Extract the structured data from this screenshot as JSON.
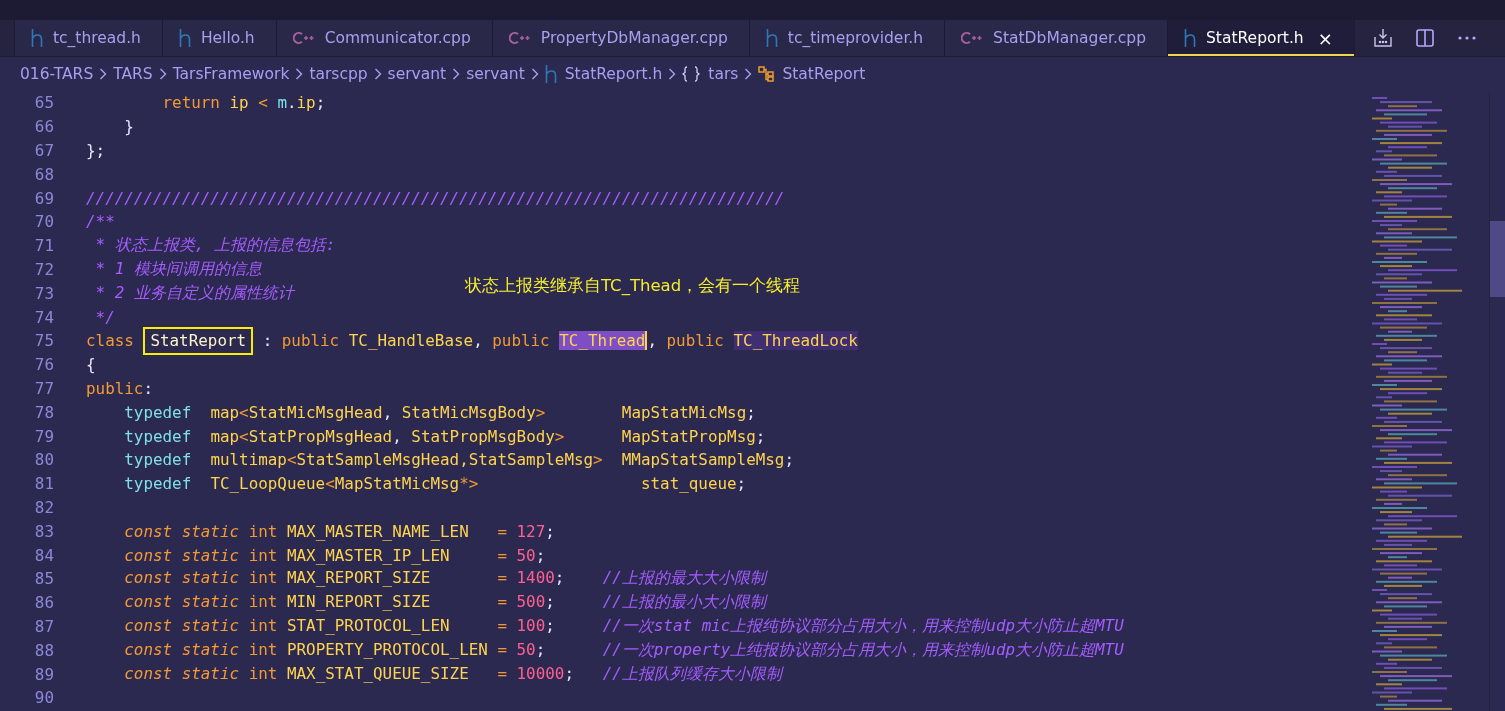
{
  "tabs": [
    {
      "kind": "h",
      "label": "tc_thread.h",
      "selected": false
    },
    {
      "kind": "h",
      "label": "Hello.h",
      "selected": false
    },
    {
      "kind": "cpp",
      "label": "Communicator.cpp",
      "selected": false
    },
    {
      "kind": "cpp",
      "label": "PropertyDbManager.cpp",
      "selected": false
    },
    {
      "kind": "h",
      "label": "tc_timeprovider.h",
      "selected": false
    },
    {
      "kind": "cpp",
      "label": "StatDbManager.cpp",
      "selected": false
    },
    {
      "kind": "h",
      "label": "StatReport.h",
      "selected": true,
      "close": "×"
    }
  ],
  "breadcrumb": [
    {
      "kind": "folder",
      "label": "016-TARS"
    },
    {
      "kind": "folder",
      "label": "TARS"
    },
    {
      "kind": "folder",
      "label": "TarsFramework"
    },
    {
      "kind": "folder",
      "label": "tarscpp"
    },
    {
      "kind": "folder",
      "label": "servant"
    },
    {
      "kind": "folder",
      "label": "servant"
    },
    {
      "kind": "file",
      "label": "StatReport.h"
    },
    {
      "kind": "namespace",
      "label": "tars"
    },
    {
      "kind": "class",
      "label": "StatReport"
    }
  ],
  "editor": {
    "lines": [
      {
        "number": "65",
        "tokens": [
          {
            "kind": "kw",
            "text": "        return"
          },
          {
            "kind": "ident",
            "text": " ip "
          },
          {
            "kind": "kw",
            "text": "<"
          },
          {
            "kind": "type",
            "text": " m"
          },
          {
            "kind": "punct",
            "text": "."
          },
          {
            "kind": "ident",
            "text": "ip"
          },
          {
            "kind": "punct",
            "text": ";"
          }
        ]
      },
      {
        "number": "66",
        "tokens": [
          {
            "kind": "punct",
            "text": "    }"
          }
        ]
      },
      {
        "number": "67",
        "tokens": [
          {
            "kind": "punct",
            "text": "};"
          }
        ]
      },
      {
        "number": "68"
      },
      {
        "number": "69",
        "tokens": [
          {
            "kind": "comment",
            "text": "/////////////////////////////////////////////////////////////////////////"
          }
        ]
      },
      {
        "number": "70",
        "tokens": [
          {
            "kind": "comment",
            "text": "/**"
          }
        ]
      },
      {
        "number": "71",
        "tokens": [
          {
            "kind": "comment",
            "text": " * 状态上报类, 上报的信息包括:"
          }
        ]
      },
      {
        "number": "72",
        "tokens": [
          {
            "kind": "comment",
            "text": " * 1 模块间调用的信息"
          }
        ]
      },
      {
        "number": "73",
        "tokens": [
          {
            "kind": "comment",
            "text": " * 2 业务自定义的属性统计"
          }
        ]
      },
      {
        "number": "74",
        "tokens": [
          {
            "kind": "comment",
            "text": " */"
          }
        ]
      },
      {
        "number": "75",
        "tokens": [
          {
            "kind": "kw",
            "text": "class "
          },
          {
            "kind": "boxed",
            "text": "StatReport"
          },
          {
            "kind": "punct",
            "text": " : "
          },
          {
            "kind": "kw",
            "text": "public"
          },
          {
            "kind": "ident",
            "text": " TC_HandleBase"
          },
          {
            "kind": "punct",
            "text": ", "
          },
          {
            "kind": "kw",
            "text": "public "
          },
          {
            "kind": "selected",
            "text": "TC_Thread"
          },
          {
            "kind": "punct",
            "text": ", "
          },
          {
            "kind": "kw",
            "text": "public "
          },
          {
            "kind": "match",
            "text": "TC_ThreadLock"
          }
        ]
      },
      {
        "number": "76",
        "tokens": [
          {
            "kind": "punct",
            "text": "{"
          }
        ]
      },
      {
        "number": "77",
        "tokens": [
          {
            "kind": "kw",
            "text": "public"
          },
          {
            "kind": "punct",
            "text": ":"
          }
        ]
      },
      {
        "number": "78",
        "tokens": [
          {
            "kind": "type",
            "text": "    typedef"
          },
          {
            "kind": "ident",
            "text": "  map"
          },
          {
            "kind": "kw",
            "text": "<"
          },
          {
            "kind": "ident",
            "text": "StatMicMsgHead"
          },
          {
            "kind": "punct",
            "text": ", "
          },
          {
            "kind": "ident",
            "text": "StatMicMsgBody"
          },
          {
            "kind": "kw",
            "text": ">"
          },
          {
            "kind": "ident",
            "text": "        MapStatMicMsg"
          },
          {
            "kind": "punct",
            "text": ";"
          }
        ]
      },
      {
        "number": "79",
        "tokens": [
          {
            "kind": "type",
            "text": "    typedef"
          },
          {
            "kind": "ident",
            "text": "  map"
          },
          {
            "kind": "kw",
            "text": "<"
          },
          {
            "kind": "ident",
            "text": "StatPropMsgHead"
          },
          {
            "kind": "punct",
            "text": ", "
          },
          {
            "kind": "ident",
            "text": "StatPropMsgBody"
          },
          {
            "kind": "kw",
            "text": ">"
          },
          {
            "kind": "ident",
            "text": "      MapStatPropMsg"
          },
          {
            "kind": "punct",
            "text": ";"
          }
        ]
      },
      {
        "number": "80",
        "tokens": [
          {
            "kind": "type",
            "text": "    typedef"
          },
          {
            "kind": "ident",
            "text": "  multimap"
          },
          {
            "kind": "kw",
            "text": "<"
          },
          {
            "kind": "ident",
            "text": "StatSampleMsgHead,StatSampleMsg"
          },
          {
            "kind": "kw",
            "text": ">"
          },
          {
            "kind": "ident",
            "text": "  MMapStatSampleMsg"
          },
          {
            "kind": "punct",
            "text": ";"
          }
        ]
      },
      {
        "number": "81",
        "tokens": [
          {
            "kind": "type",
            "text": "    typedef"
          },
          {
            "kind": "ident",
            "text": "  TC_LoopQueue"
          },
          {
            "kind": "kw",
            "text": "<"
          },
          {
            "kind": "ident",
            "text": "MapStatMicMsg"
          },
          {
            "kind": "kw",
            "text": "*>"
          },
          {
            "kind": "ident",
            "text": "                 stat_queue"
          },
          {
            "kind": "punct",
            "text": ";"
          }
        ]
      },
      {
        "number": "82"
      },
      {
        "number": "83",
        "tokens": [
          {
            "kind": "kwi",
            "text": "    const static"
          },
          {
            "kind": "kw",
            "text": " int"
          },
          {
            "kind": "ident",
            "text": " MAX_MASTER_NAME_LEN   "
          },
          {
            "kind": "kw",
            "text": "="
          },
          {
            "kind": "num",
            "text": " 127"
          },
          {
            "kind": "punct",
            "text": ";"
          }
        ]
      },
      {
        "number": "84",
        "tokens": [
          {
            "kind": "kwi",
            "text": "    const static"
          },
          {
            "kind": "kw",
            "text": " int"
          },
          {
            "kind": "ident",
            "text": " MAX_MASTER_IP_LEN     "
          },
          {
            "kind": "kw",
            "text": "="
          },
          {
            "kind": "num",
            "text": " 50"
          },
          {
            "kind": "punct",
            "text": ";"
          }
        ]
      },
      {
        "number": "85",
        "tokens": [
          {
            "kind": "kwi",
            "text": "    const static"
          },
          {
            "kind": "kw",
            "text": " int"
          },
          {
            "kind": "ident",
            "text": " MAX_REPORT_SIZE       "
          },
          {
            "kind": "kw",
            "text": "="
          },
          {
            "kind": "num",
            "text": " 1400"
          },
          {
            "kind": "punct",
            "text": ";    "
          },
          {
            "kind": "comment",
            "text": "//上报的最大大小限制"
          }
        ]
      },
      {
        "number": "86",
        "tokens": [
          {
            "kind": "kwi",
            "text": "    const static"
          },
          {
            "kind": "kw",
            "text": " int"
          },
          {
            "kind": "ident",
            "text": " MIN_REPORT_SIZE       "
          },
          {
            "kind": "kw",
            "text": "="
          },
          {
            "kind": "num",
            "text": " 500"
          },
          {
            "kind": "punct",
            "text": ";     "
          },
          {
            "kind": "comment",
            "text": "//上报的最小大小限制"
          }
        ]
      },
      {
        "number": "87",
        "tokens": [
          {
            "kind": "kwi",
            "text": "    const static"
          },
          {
            "kind": "kw",
            "text": " int"
          },
          {
            "kind": "ident",
            "text": " STAT_PROTOCOL_LEN     "
          },
          {
            "kind": "kw",
            "text": "="
          },
          {
            "kind": "num",
            "text": " 100"
          },
          {
            "kind": "punct",
            "text": ";     "
          },
          {
            "kind": "comment",
            "text": "//一次stat mic上报纯协议部分占用大小，用来控制udp大小防止超MTU"
          }
        ]
      },
      {
        "number": "88",
        "tokens": [
          {
            "kind": "kwi",
            "text": "    const static"
          },
          {
            "kind": "kw",
            "text": " int"
          },
          {
            "kind": "ident",
            "text": " PROPERTY_PROTOCOL_LEN "
          },
          {
            "kind": "kw",
            "text": "="
          },
          {
            "kind": "num",
            "text": " 50"
          },
          {
            "kind": "punct",
            "text": ";      "
          },
          {
            "kind": "comment",
            "text": "//一次property上纯报协议部分占用大小，用来控制udp大小防止超MTU"
          }
        ]
      },
      {
        "number": "89",
        "tokens": [
          {
            "kind": "kwi",
            "text": "    const static"
          },
          {
            "kind": "kw",
            "text": " int"
          },
          {
            "kind": "ident",
            "text": " MAX_STAT_QUEUE_SIZE   "
          },
          {
            "kind": "kw",
            "text": "="
          },
          {
            "kind": "num",
            "text": " 10000"
          },
          {
            "kind": "punct",
            "text": ";   "
          },
          {
            "kind": "comment",
            "text": "//上报队列缓存大小限制"
          }
        ]
      },
      {
        "number": "90"
      }
    ],
    "annotation": "状态上报类继承自TC_Thead，会有一个线程"
  }
}
